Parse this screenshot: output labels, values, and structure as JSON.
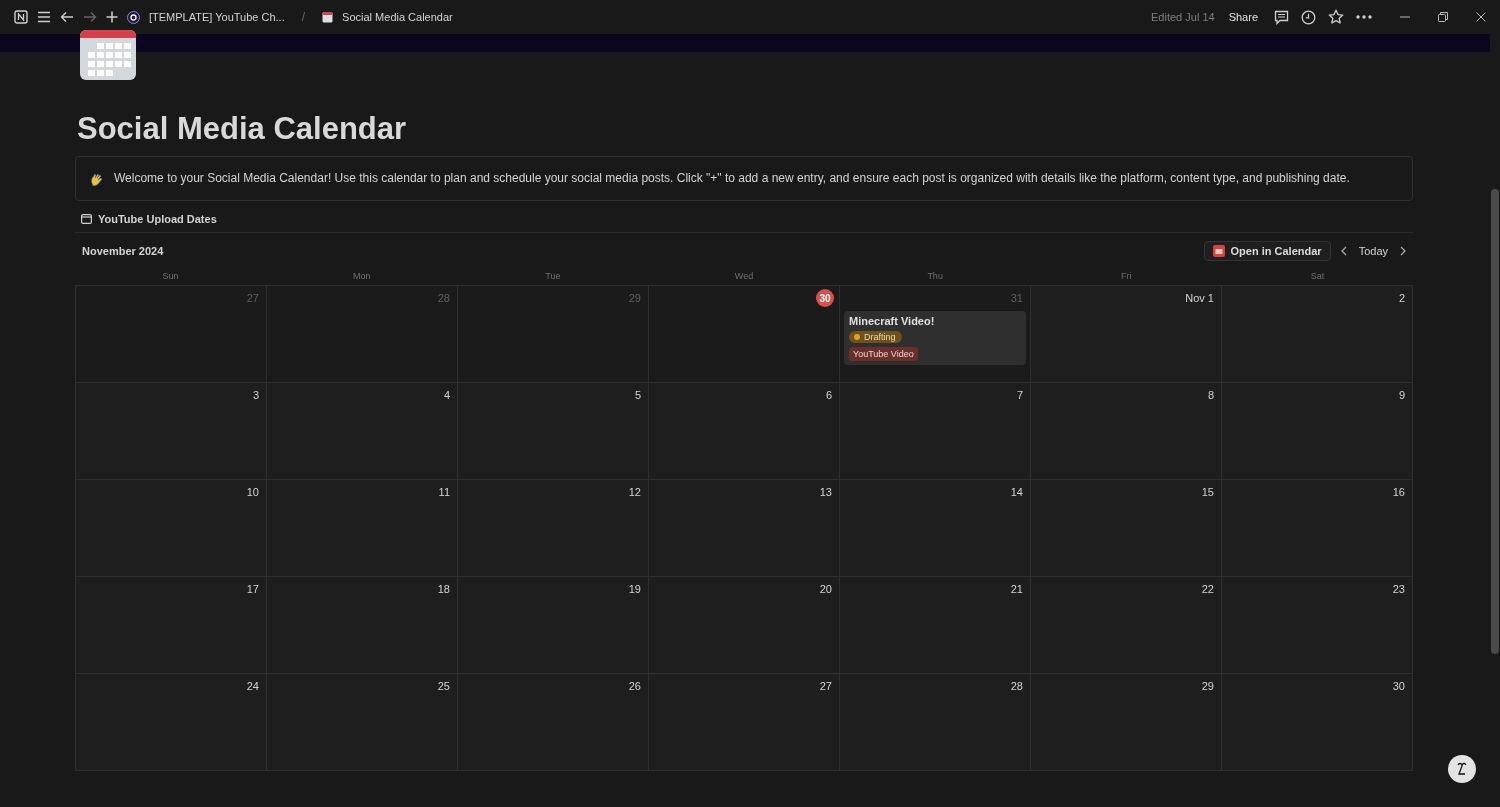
{
  "topbar": {
    "breadcrumbs": [
      {
        "text": "[TEMPLATE] YouTube Ch...",
        "kind": "workspace"
      },
      {
        "text": "Social Media Calendar",
        "kind": "page"
      }
    ],
    "separator": "/",
    "forward_disabled": true,
    "edited": "Edited Jul 14",
    "share": "Share"
  },
  "page": {
    "title": "Social Media Calendar"
  },
  "callout": {
    "text": "Welcome to your Social Media Calendar! Use this calendar to plan and schedule your social media posts. Click \"+\" to add a new entry, and ensure each post is organized with details like the platform, content type, and publishing date."
  },
  "database": {
    "title": "YouTube Upload Dates"
  },
  "calendar": {
    "month": "November 2024",
    "open_button": "Open in Calendar",
    "today_button": "Today",
    "weekdays": [
      "Sun",
      "Mon",
      "Tue",
      "Wed",
      "Thu",
      "Fri",
      "Sat"
    ],
    "weeks": [
      [
        {
          "label": "27",
          "in_month": false,
          "today": false
        },
        {
          "label": "28",
          "in_month": false,
          "today": false
        },
        {
          "label": "29",
          "in_month": false,
          "today": false
        },
        {
          "label": "30",
          "in_month": false,
          "today": true
        },
        {
          "label": "31",
          "in_month": false,
          "today": false,
          "events": [
            {
              "title": "Minecraft Video!",
              "status": {
                "label": "Drafting",
                "color": "#d9a12c"
              },
              "type": {
                "label": "YouTube Video",
                "color": "#6b2f2b"
              }
            }
          ]
        },
        {
          "label": "Nov 1",
          "in_month": true,
          "today": false
        },
        {
          "label": "2",
          "in_month": true,
          "today": false
        }
      ],
      [
        {
          "label": "3",
          "in_month": true,
          "today": false
        },
        {
          "label": "4",
          "in_month": true,
          "today": false
        },
        {
          "label": "5",
          "in_month": true,
          "today": false
        },
        {
          "label": "6",
          "in_month": true,
          "today": false
        },
        {
          "label": "7",
          "in_month": true,
          "today": false
        },
        {
          "label": "8",
          "in_month": true,
          "today": false
        },
        {
          "label": "9",
          "in_month": true,
          "today": false
        }
      ],
      [
        {
          "label": "10",
          "in_month": true,
          "today": false
        },
        {
          "label": "11",
          "in_month": true,
          "today": false
        },
        {
          "label": "12",
          "in_month": true,
          "today": false
        },
        {
          "label": "13",
          "in_month": true,
          "today": false
        },
        {
          "label": "14",
          "in_month": true,
          "today": false
        },
        {
          "label": "15",
          "in_month": true,
          "today": false
        },
        {
          "label": "16",
          "in_month": true,
          "today": false
        }
      ],
      [
        {
          "label": "17",
          "in_month": true,
          "today": false
        },
        {
          "label": "18",
          "in_month": true,
          "today": false
        },
        {
          "label": "19",
          "in_month": true,
          "today": false
        },
        {
          "label": "20",
          "in_month": true,
          "today": false
        },
        {
          "label": "21",
          "in_month": true,
          "today": false
        },
        {
          "label": "22",
          "in_month": true,
          "today": false
        },
        {
          "label": "23",
          "in_month": true,
          "today": false
        }
      ],
      [
        {
          "label": "24",
          "in_month": true,
          "today": false
        },
        {
          "label": "25",
          "in_month": true,
          "today": false
        },
        {
          "label": "26",
          "in_month": true,
          "today": false
        },
        {
          "label": "27",
          "in_month": true,
          "today": false
        },
        {
          "label": "28",
          "in_month": true,
          "today": false
        },
        {
          "label": "29",
          "in_month": true,
          "today": false
        },
        {
          "label": "30",
          "in_month": true,
          "today": false
        }
      ]
    ]
  }
}
